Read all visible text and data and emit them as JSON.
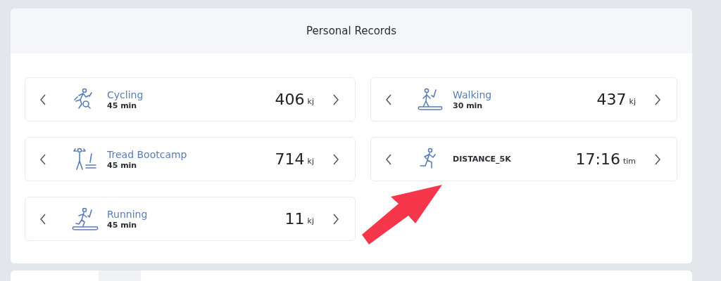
{
  "panel": {
    "title": "Personal Records"
  },
  "records": [
    {
      "kind": "cycling",
      "name": "Cycling",
      "duration": "45 min",
      "value": "406",
      "unit": "kj"
    },
    {
      "kind": "walking",
      "name": "Walking",
      "duration": "30 min",
      "value": "437",
      "unit": "kj"
    },
    {
      "kind": "bootcamp",
      "name": "Tread Bootcamp",
      "duration": "45 min",
      "value": "714",
      "unit": "kj"
    },
    {
      "kind": "distance",
      "name": "DISTANCE_5K",
      "value": "17:16",
      "unit": "tim"
    },
    {
      "kind": "running",
      "name": "Running",
      "duration": "45 min",
      "value": "11",
      "unit": "kj"
    }
  ]
}
